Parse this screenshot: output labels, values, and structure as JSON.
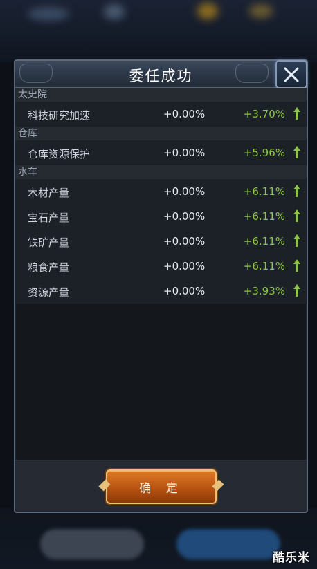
{
  "modal": {
    "title": "委任成功",
    "confirm_label": "确 定"
  },
  "categories": [
    {
      "name": "太史院",
      "rows": [
        {
          "label": "科技研究加速",
          "base": "+0.00%",
          "bonus": "+3.70%"
        }
      ]
    },
    {
      "name": "仓库",
      "rows": [
        {
          "label": "仓库资源保护",
          "base": "+0.00%",
          "bonus": "+5.96%"
        }
      ]
    },
    {
      "name": "水车",
      "rows": [
        {
          "label": "木材产量",
          "base": "+0.00%",
          "bonus": "+6.11%"
        },
        {
          "label": "宝石产量",
          "base": "+0.00%",
          "bonus": "+6.11%"
        },
        {
          "label": "铁矿产量",
          "base": "+0.00%",
          "bonus": "+6.11%"
        },
        {
          "label": "粮食产量",
          "base": "+0.00%",
          "bonus": "+6.11%"
        },
        {
          "label": "资源产量",
          "base": "+0.00%",
          "bonus": "+3.93%"
        }
      ]
    }
  ],
  "watermark": "酷乐米",
  "colors": {
    "bonus": "#8cc63f",
    "button": "#c85f1a",
    "header": "#2b3646"
  },
  "icons": {
    "close": "close-x-icon",
    "increase": "up-arrow-icon"
  }
}
